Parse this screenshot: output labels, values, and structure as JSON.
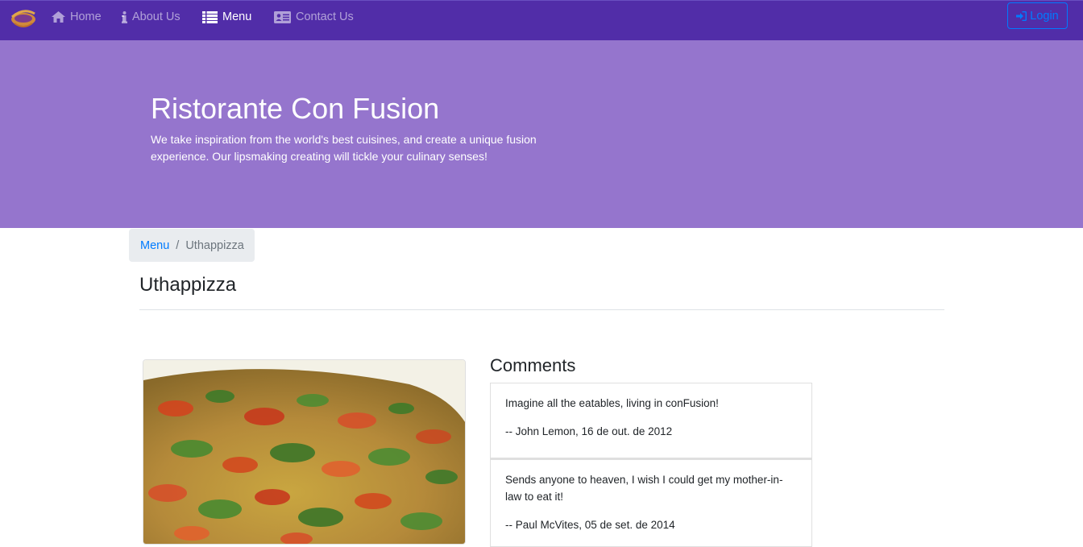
{
  "navbar": {
    "brand_icon": "confusion-logo",
    "items": [
      {
        "label": "Home",
        "icon": "home-icon",
        "active": false
      },
      {
        "label": "About Us",
        "icon": "info-icon",
        "active": false
      },
      {
        "label": "Menu",
        "icon": "list-icon",
        "active": true
      },
      {
        "label": "Contact Us",
        "icon": "address-card-icon",
        "active": false
      }
    ],
    "login_label": "Login",
    "login_icon": "sign-in-icon",
    "colors": {
      "background": "#512DA8",
      "login": "#007bff"
    }
  },
  "jumbotron": {
    "title": "Ristorante Con Fusion",
    "text": "We take inspiration from the world's best cuisines, and create a unique fusion experience. Our lipsmaking creating will tickle your culinary senses!",
    "background": "#9575CD"
  },
  "breadcrumb": {
    "items": [
      {
        "label": "Menu",
        "link": true
      },
      {
        "label": "Uthappizza",
        "link": false
      }
    ],
    "separator": "/"
  },
  "page": {
    "title": "Uthappizza"
  },
  "dish": {
    "image_alt": "Uthappizza"
  },
  "comments": {
    "heading": "Comments",
    "items": [
      {
        "text": "Imagine all the eatables, living in conFusion!",
        "meta": "-- John Lemon, 16 de out. de 2012"
      },
      {
        "text": "Sends anyone to heaven, I wish I could get my mother-in-law to eat it!",
        "meta": "-- Paul McVites, 05 de set. de 2014"
      }
    ]
  }
}
